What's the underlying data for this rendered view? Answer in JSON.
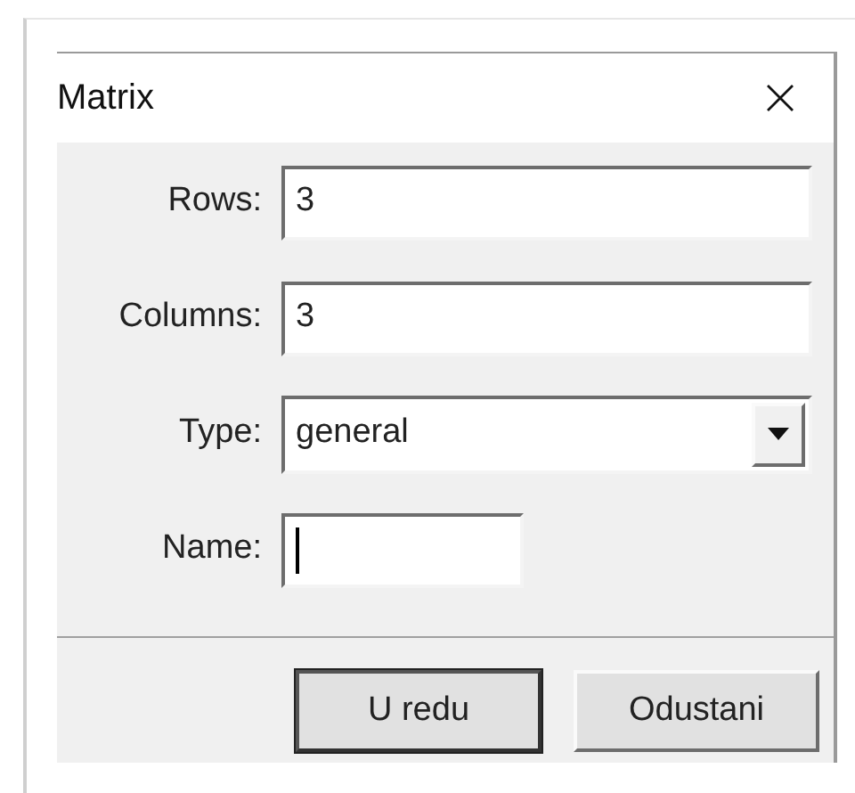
{
  "window": {
    "title": "Matrix"
  },
  "fields": [
    {
      "label": "Rows:",
      "kind": "text",
      "value": "3",
      "focused": false,
      "wide": true
    },
    {
      "label": "Columns:",
      "kind": "text",
      "value": "3",
      "focused": false,
      "wide": true
    },
    {
      "label": "Type:",
      "kind": "select",
      "value": "general",
      "focused": false,
      "wide": true
    },
    {
      "label": "Name:",
      "kind": "text",
      "focused": true,
      "wide": false
    }
  ],
  "buttons": [
    {
      "label": "U redu",
      "default": true
    },
    {
      "label": "Odustani",
      "default": false
    }
  ]
}
